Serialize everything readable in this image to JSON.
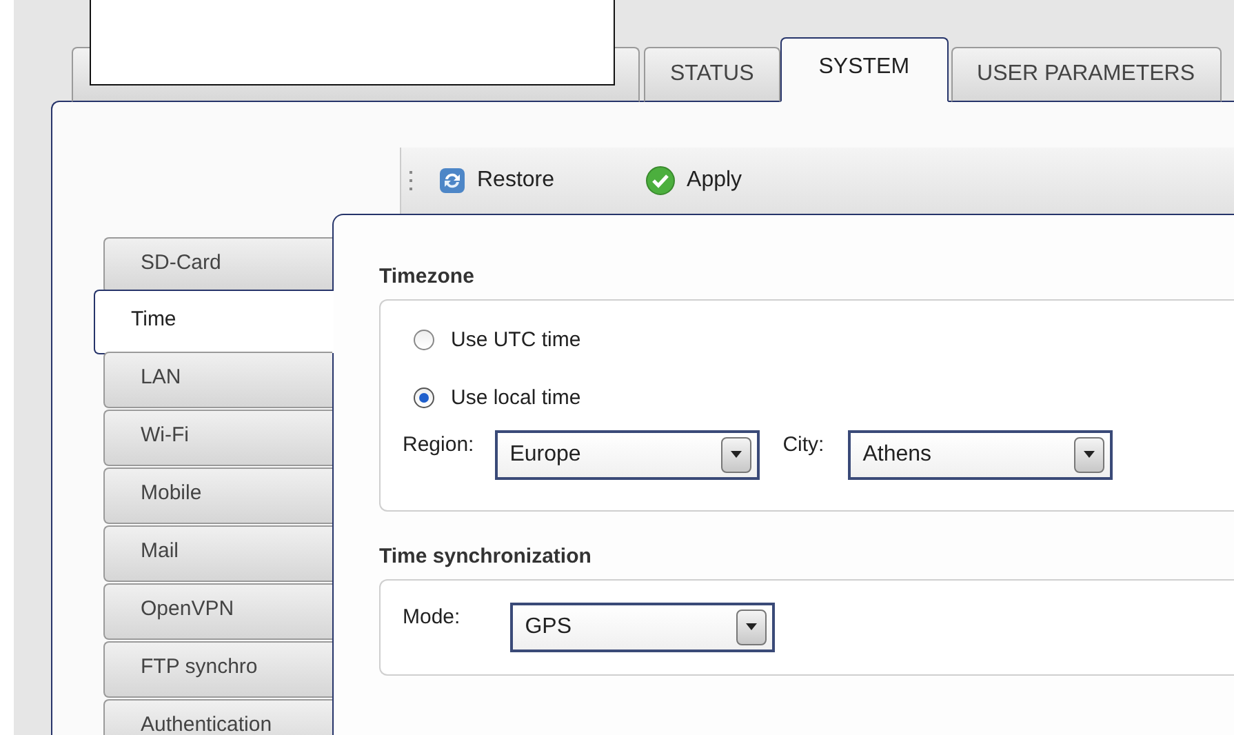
{
  "main_tabs": [
    {
      "label": "STATUS",
      "selected": false
    },
    {
      "label": "SYSTEM",
      "selected": true
    },
    {
      "label": "USER PARAMETERS",
      "selected": false
    }
  ],
  "toolbar": {
    "buttons": [
      {
        "label": "Restore",
        "kind": "restore"
      },
      {
        "label": "Apply",
        "kind": "apply"
      }
    ]
  },
  "side_tabs": [
    {
      "label": "SD-Card",
      "selected": false
    },
    {
      "label": "Time",
      "selected": true
    },
    {
      "label": "LAN",
      "selected": false
    },
    {
      "label": "Wi-Fi",
      "selected": false
    },
    {
      "label": "Mobile",
      "selected": false
    },
    {
      "label": "Mail",
      "selected": false
    },
    {
      "label": "OpenVPN",
      "selected": false
    },
    {
      "label": "FTP synchro",
      "selected": false
    },
    {
      "label": "Authentication",
      "selected": false
    }
  ],
  "timezone": {
    "title": "Timezone",
    "options": [
      {
        "label": "Use UTC time",
        "selected": false
      },
      {
        "label": "Use local time",
        "selected": true
      }
    ],
    "region": {
      "label": "Region:",
      "value": "Europe"
    },
    "city": {
      "label": "City:",
      "value": "Athens"
    }
  },
  "time_sync": {
    "title": "Time synchronization",
    "mode": {
      "label": "Mode:",
      "value": "GPS"
    }
  }
}
